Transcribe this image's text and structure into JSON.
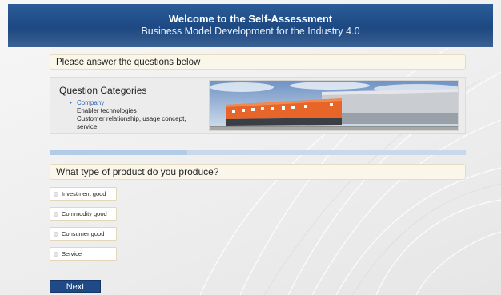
{
  "header": {
    "title": "Welcome to the Self-Assessment",
    "subtitle": "Business Model Development for the Industry 4.0"
  },
  "instructions": "Please answer the questions below",
  "categories": {
    "title": "Question Categories",
    "items": [
      {
        "label": "Company",
        "active": true
      },
      {
        "label": "Enabler technologies",
        "active": false
      },
      {
        "label": "Customer relationship, usage concept, service",
        "active": false
      }
    ],
    "image_description_icon": "factory-building-photo"
  },
  "progress": {
    "value": 0.33
  },
  "question": {
    "text": "What type of product do you produce?",
    "options": [
      {
        "label": "Investment good",
        "selected": false
      },
      {
        "label": "Commodity good",
        "selected": false
      },
      {
        "label": "Consumer good",
        "selected": false
      },
      {
        "label": "Service",
        "selected": false
      }
    ]
  },
  "next_button": {
    "label": "Next"
  },
  "colors": {
    "header_blue": "#1f4c86",
    "active_category": "#2e63b0",
    "bar_background": "#faf6ea"
  }
}
